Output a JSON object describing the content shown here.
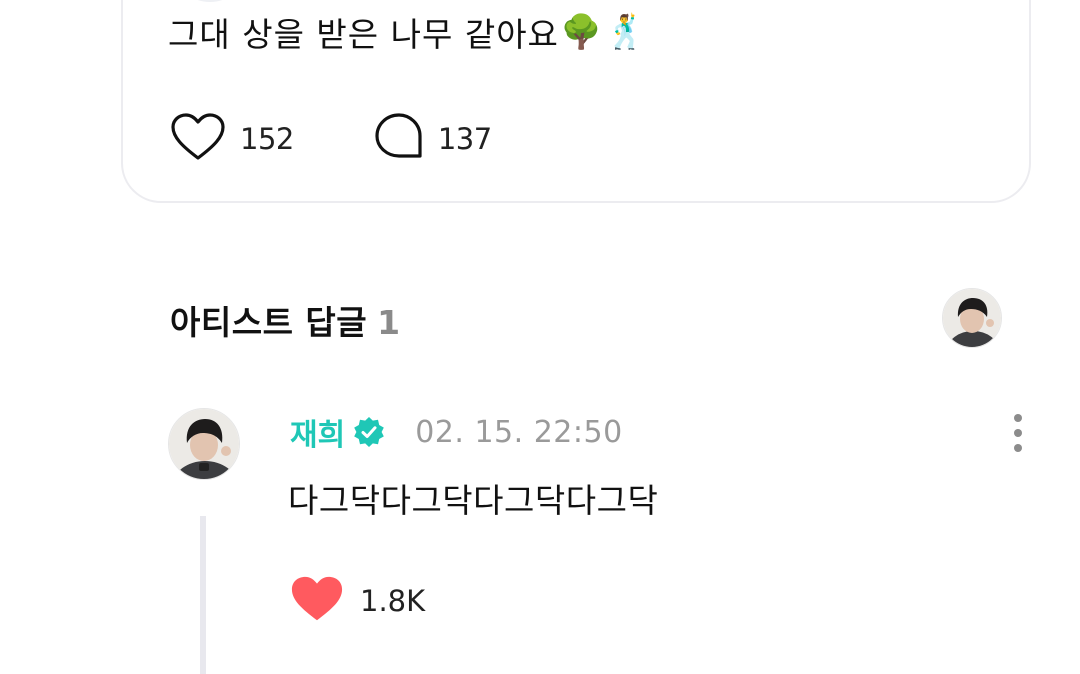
{
  "post": {
    "text": "그대 상을 받은 나무 같아요",
    "emoji_tree": "🌳",
    "emoji_dancer": "🕺",
    "likes": "152",
    "comments": "137"
  },
  "artist_replies": {
    "title": "아티스트 답글",
    "count": "1"
  },
  "reply": {
    "author": "재희",
    "date": "02. 15. 22:50",
    "text": "다그닥다그닥다그닥다그닥",
    "likes": "1.8K"
  },
  "colors": {
    "accent": "#1fc7b6",
    "heart_filled": "#ff5a5f",
    "card_border": "#ececf0"
  }
}
